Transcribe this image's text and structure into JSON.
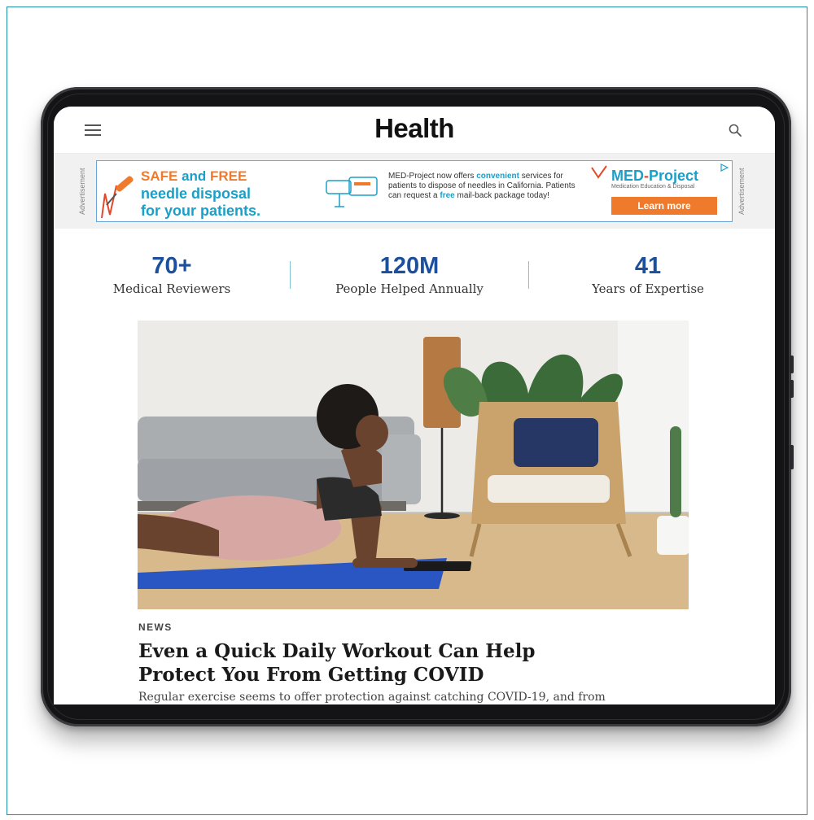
{
  "header": {
    "logo": "Health",
    "menu_icon": "hamburger-menu-icon",
    "search_icon": "search-icon"
  },
  "ad": {
    "side_label": "Advertisement",
    "headline_safe": "SAFE",
    "headline_and": " and ",
    "headline_free": "FREE",
    "line2": "needle disposal",
    "line3": "for your patients.",
    "body_1": "MED-Project now offers ",
    "body_highlight": "convenient",
    "body_2": " services for patients to dispose of needles in California. Patients can request a ",
    "body_free": "free",
    "body_3": " mail-back package today!",
    "brand_a": "MED",
    "brand_dash": "-",
    "brand_b": "Project",
    "brand_tagline": "Medication Education & Disposal",
    "cta": "Learn more",
    "colors": {
      "orange": "#f07a2c",
      "blue": "#1aa0c8"
    }
  },
  "stats": [
    {
      "number": "70+",
      "label": "Medical Reviewers"
    },
    {
      "number": "120M",
      "label": "People Helped Annually"
    },
    {
      "number": "41",
      "label": "Years of Expertise"
    }
  ],
  "article": {
    "kicker": "NEWS",
    "headline_line1": "Even a Quick Daily Workout Can Help",
    "headline_line2": "Protect You From Getting COVID",
    "dek": "Regular exercise seems to offer protection against catching COVID-19, and from"
  },
  "theme": {
    "stat_color": "#1c4f9c",
    "divider_color": "#7fc6d4",
    "frame_border": "#1e8fa6"
  }
}
